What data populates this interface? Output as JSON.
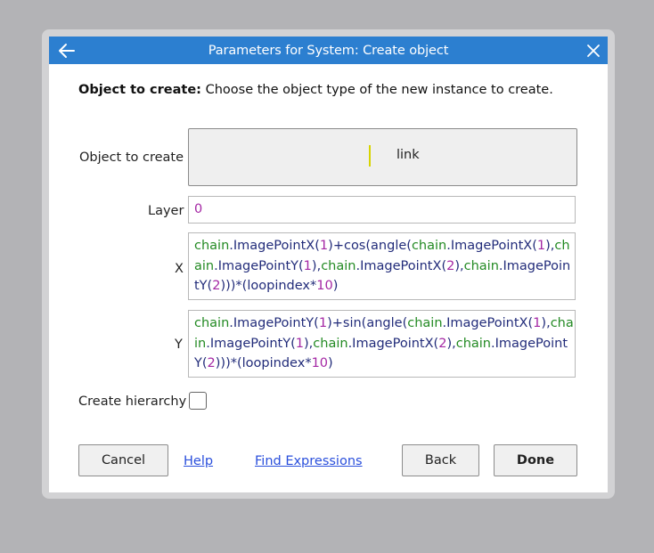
{
  "dialog": {
    "title": "Parameters for System: Create object",
    "back_icon": "arrow-left-icon",
    "close_icon": "close-icon"
  },
  "description": {
    "bold": "Object to create:",
    "text": " Choose the object type of the new instance to create."
  },
  "params": {
    "object_label": "Object to create",
    "object_value": "link",
    "layer_label": "Layer",
    "layer_value": "0",
    "x_label": "X",
    "x_tokens": [
      {
        "t": "chain",
        "c": "obj"
      },
      {
        "t": ".ImagePointX",
        "c": "fn"
      },
      {
        "t": "(",
        "c": "op"
      },
      {
        "t": "1",
        "c": "num"
      },
      {
        "t": ")+",
        "c": "op"
      },
      {
        "t": "cos",
        "c": "fn"
      },
      {
        "t": "(",
        "c": "op"
      },
      {
        "t": "angle",
        "c": "fn"
      },
      {
        "t": "(",
        "c": "op"
      },
      {
        "t": "chain",
        "c": "obj"
      },
      {
        "t": ".ImagePointX",
        "c": "fn"
      },
      {
        "t": "(",
        "c": "op"
      },
      {
        "t": "1",
        "c": "num"
      },
      {
        "t": "),",
        "c": "op"
      },
      {
        "t": "chain",
        "c": "obj"
      },
      {
        "t": ".ImagePointY",
        "c": "fn"
      },
      {
        "t": "(",
        "c": "op"
      },
      {
        "t": "1",
        "c": "num"
      },
      {
        "t": "),",
        "c": "op"
      },
      {
        "t": "chain",
        "c": "obj"
      },
      {
        "t": ".ImagePointX",
        "c": "fn"
      },
      {
        "t": "(",
        "c": "op"
      },
      {
        "t": "2",
        "c": "num"
      },
      {
        "t": "),",
        "c": "op"
      },
      {
        "t": "chain",
        "c": "obj"
      },
      {
        "t": ".ImagePointY",
        "c": "fn"
      },
      {
        "t": "(",
        "c": "op"
      },
      {
        "t": "2",
        "c": "num"
      },
      {
        "t": ")))*(",
        "c": "op"
      },
      {
        "t": "loopindex",
        "c": "fn"
      },
      {
        "t": "*",
        "c": "op"
      },
      {
        "t": "10",
        "c": "num"
      },
      {
        "t": ")",
        "c": "op"
      }
    ],
    "y_label": "Y",
    "y_tokens": [
      {
        "t": "chain",
        "c": "obj"
      },
      {
        "t": ".ImagePointY",
        "c": "fn"
      },
      {
        "t": "(",
        "c": "op"
      },
      {
        "t": "1",
        "c": "num"
      },
      {
        "t": ")+",
        "c": "op"
      },
      {
        "t": "sin",
        "c": "fn"
      },
      {
        "t": "(",
        "c": "op"
      },
      {
        "t": "angle",
        "c": "fn"
      },
      {
        "t": "(",
        "c": "op"
      },
      {
        "t": "chain",
        "c": "obj"
      },
      {
        "t": ".ImagePointX",
        "c": "fn"
      },
      {
        "t": "(",
        "c": "op"
      },
      {
        "t": "1",
        "c": "num"
      },
      {
        "t": "),",
        "c": "op"
      },
      {
        "t": "chain",
        "c": "obj"
      },
      {
        "t": ".ImagePointY",
        "c": "fn"
      },
      {
        "t": "(",
        "c": "op"
      },
      {
        "t": "1",
        "c": "num"
      },
      {
        "t": "),",
        "c": "op"
      },
      {
        "t": "chain",
        "c": "obj"
      },
      {
        "t": ".ImagePointX",
        "c": "fn"
      },
      {
        "t": "(",
        "c": "op"
      },
      {
        "t": "2",
        "c": "num"
      },
      {
        "t": "),",
        "c": "op"
      },
      {
        "t": "chain",
        "c": "obj"
      },
      {
        "t": ".ImagePointY",
        "c": "fn"
      },
      {
        "t": "(",
        "c": "op"
      },
      {
        "t": "2",
        "c": "num"
      },
      {
        "t": ")))*(",
        "c": "op"
      },
      {
        "t": "loopindex",
        "c": "fn"
      },
      {
        "t": "*",
        "c": "op"
      },
      {
        "t": "10",
        "c": "num"
      },
      {
        "t": ")",
        "c": "op"
      }
    ],
    "hierarchy_label": "Create hierarchy",
    "hierarchy_checked": false
  },
  "footer": {
    "cancel": "Cancel",
    "help": "Help",
    "find_expressions": "Find Expressions",
    "back": "Back",
    "done": "Done"
  },
  "colors": {
    "titlebar": "#2c7fd0",
    "object_token": "#238a23",
    "function_token": "#222c7a",
    "number_token": "#a427a4",
    "link": "#2a4fdc"
  }
}
